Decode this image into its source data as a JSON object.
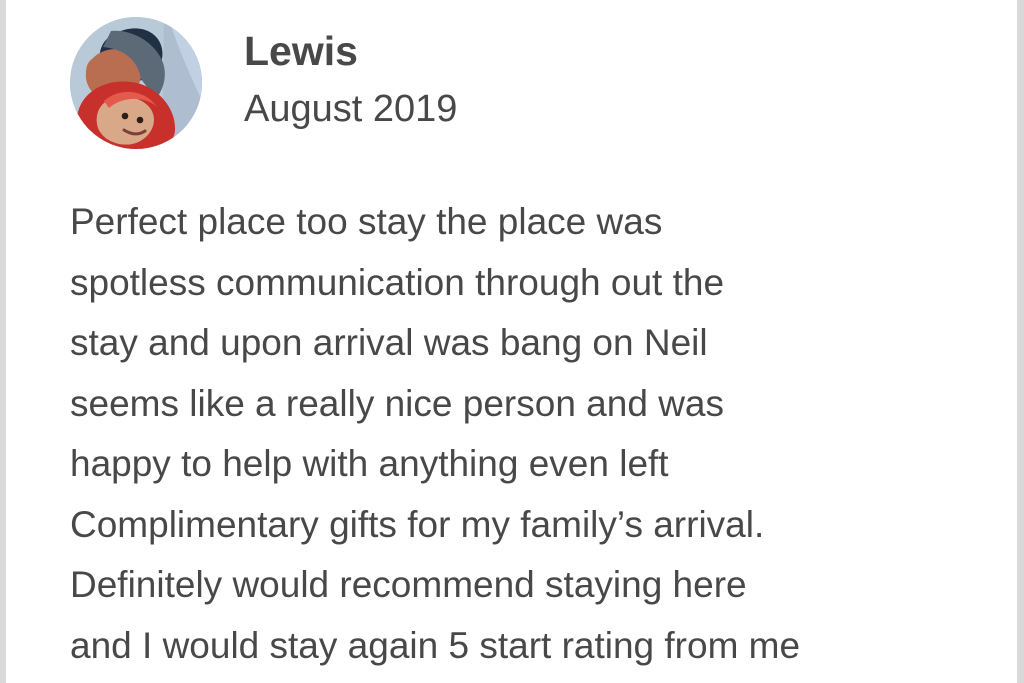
{
  "review": {
    "reviewer_name": "Lewis",
    "date": "August 2019",
    "text": "Perfect place too stay the place was\nspotless communication through out the\nstay and upon arrival was bang on Neil\nseems like a really nice person and was\nhappy to help with anything even left\nComplimentary gifts for my family’s arrival.\nDefinitely would recommend staying here\nand I would stay again 5 start rating from me",
    "avatar": {
      "icon": "reviewer-avatar-photo",
      "colors": {
        "sky": "#b8c9d8",
        "hood": "#c8302c",
        "hat": "#223044",
        "skin": "#d9a889"
      }
    }
  },
  "colors": {
    "text": "#484848",
    "background": "#ffffff",
    "frame": "#d9d9d9"
  }
}
